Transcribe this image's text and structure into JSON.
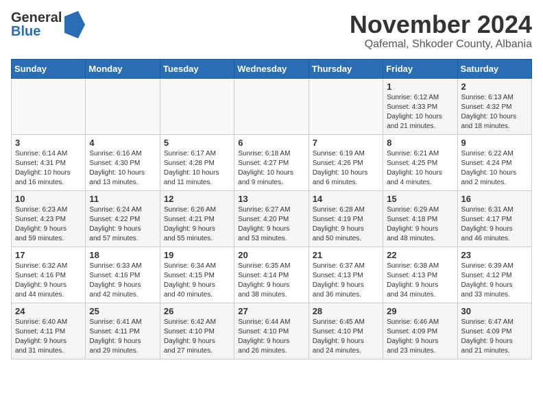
{
  "header": {
    "logo_line1": "General",
    "logo_line2": "Blue",
    "month": "November 2024",
    "location": "Qafemal, Shkoder County, Albania"
  },
  "weekdays": [
    "Sunday",
    "Monday",
    "Tuesday",
    "Wednesday",
    "Thursday",
    "Friday",
    "Saturday"
  ],
  "weeks": [
    [
      {
        "day": "",
        "info": ""
      },
      {
        "day": "",
        "info": ""
      },
      {
        "day": "",
        "info": ""
      },
      {
        "day": "",
        "info": ""
      },
      {
        "day": "",
        "info": ""
      },
      {
        "day": "1",
        "info": "Sunrise: 6:12 AM\nSunset: 4:33 PM\nDaylight: 10 hours\nand 21 minutes."
      },
      {
        "day": "2",
        "info": "Sunrise: 6:13 AM\nSunset: 4:32 PM\nDaylight: 10 hours\nand 18 minutes."
      }
    ],
    [
      {
        "day": "3",
        "info": "Sunrise: 6:14 AM\nSunset: 4:31 PM\nDaylight: 10 hours\nand 16 minutes."
      },
      {
        "day": "4",
        "info": "Sunrise: 6:16 AM\nSunset: 4:30 PM\nDaylight: 10 hours\nand 13 minutes."
      },
      {
        "day": "5",
        "info": "Sunrise: 6:17 AM\nSunset: 4:28 PM\nDaylight: 10 hours\nand 11 minutes."
      },
      {
        "day": "6",
        "info": "Sunrise: 6:18 AM\nSunset: 4:27 PM\nDaylight: 10 hours\nand 9 minutes."
      },
      {
        "day": "7",
        "info": "Sunrise: 6:19 AM\nSunset: 4:26 PM\nDaylight: 10 hours\nand 6 minutes."
      },
      {
        "day": "8",
        "info": "Sunrise: 6:21 AM\nSunset: 4:25 PM\nDaylight: 10 hours\nand 4 minutes."
      },
      {
        "day": "9",
        "info": "Sunrise: 6:22 AM\nSunset: 4:24 PM\nDaylight: 10 hours\nand 2 minutes."
      }
    ],
    [
      {
        "day": "10",
        "info": "Sunrise: 6:23 AM\nSunset: 4:23 PM\nDaylight: 9 hours\nand 59 minutes."
      },
      {
        "day": "11",
        "info": "Sunrise: 6:24 AM\nSunset: 4:22 PM\nDaylight: 9 hours\nand 57 minutes."
      },
      {
        "day": "12",
        "info": "Sunrise: 6:26 AM\nSunset: 4:21 PM\nDaylight: 9 hours\nand 55 minutes."
      },
      {
        "day": "13",
        "info": "Sunrise: 6:27 AM\nSunset: 4:20 PM\nDaylight: 9 hours\nand 53 minutes."
      },
      {
        "day": "14",
        "info": "Sunrise: 6:28 AM\nSunset: 4:19 PM\nDaylight: 9 hours\nand 50 minutes."
      },
      {
        "day": "15",
        "info": "Sunrise: 6:29 AM\nSunset: 4:18 PM\nDaylight: 9 hours\nand 48 minutes."
      },
      {
        "day": "16",
        "info": "Sunrise: 6:31 AM\nSunset: 4:17 PM\nDaylight: 9 hours\nand 46 minutes."
      }
    ],
    [
      {
        "day": "17",
        "info": "Sunrise: 6:32 AM\nSunset: 4:16 PM\nDaylight: 9 hours\nand 44 minutes."
      },
      {
        "day": "18",
        "info": "Sunrise: 6:33 AM\nSunset: 4:16 PM\nDaylight: 9 hours\nand 42 minutes."
      },
      {
        "day": "19",
        "info": "Sunrise: 6:34 AM\nSunset: 4:15 PM\nDaylight: 9 hours\nand 40 minutes."
      },
      {
        "day": "20",
        "info": "Sunrise: 6:35 AM\nSunset: 4:14 PM\nDaylight: 9 hours\nand 38 minutes."
      },
      {
        "day": "21",
        "info": "Sunrise: 6:37 AM\nSunset: 4:13 PM\nDaylight: 9 hours\nand 36 minutes."
      },
      {
        "day": "22",
        "info": "Sunrise: 6:38 AM\nSunset: 4:13 PM\nDaylight: 9 hours\nand 34 minutes."
      },
      {
        "day": "23",
        "info": "Sunrise: 6:39 AM\nSunset: 4:12 PM\nDaylight: 9 hours\nand 33 minutes."
      }
    ],
    [
      {
        "day": "24",
        "info": "Sunrise: 6:40 AM\nSunset: 4:11 PM\nDaylight: 9 hours\nand 31 minutes."
      },
      {
        "day": "25",
        "info": "Sunrise: 6:41 AM\nSunset: 4:11 PM\nDaylight: 9 hours\nand 29 minutes."
      },
      {
        "day": "26",
        "info": "Sunrise: 6:42 AM\nSunset: 4:10 PM\nDaylight: 9 hours\nand 27 minutes."
      },
      {
        "day": "27",
        "info": "Sunrise: 6:44 AM\nSunset: 4:10 PM\nDaylight: 9 hours\nand 26 minutes."
      },
      {
        "day": "28",
        "info": "Sunrise: 6:45 AM\nSunset: 4:10 PM\nDaylight: 9 hours\nand 24 minutes."
      },
      {
        "day": "29",
        "info": "Sunrise: 6:46 AM\nSunset: 4:09 PM\nDaylight: 9 hours\nand 23 minutes."
      },
      {
        "day": "30",
        "info": "Sunrise: 6:47 AM\nSunset: 4:09 PM\nDaylight: 9 hours\nand 21 minutes."
      }
    ]
  ]
}
